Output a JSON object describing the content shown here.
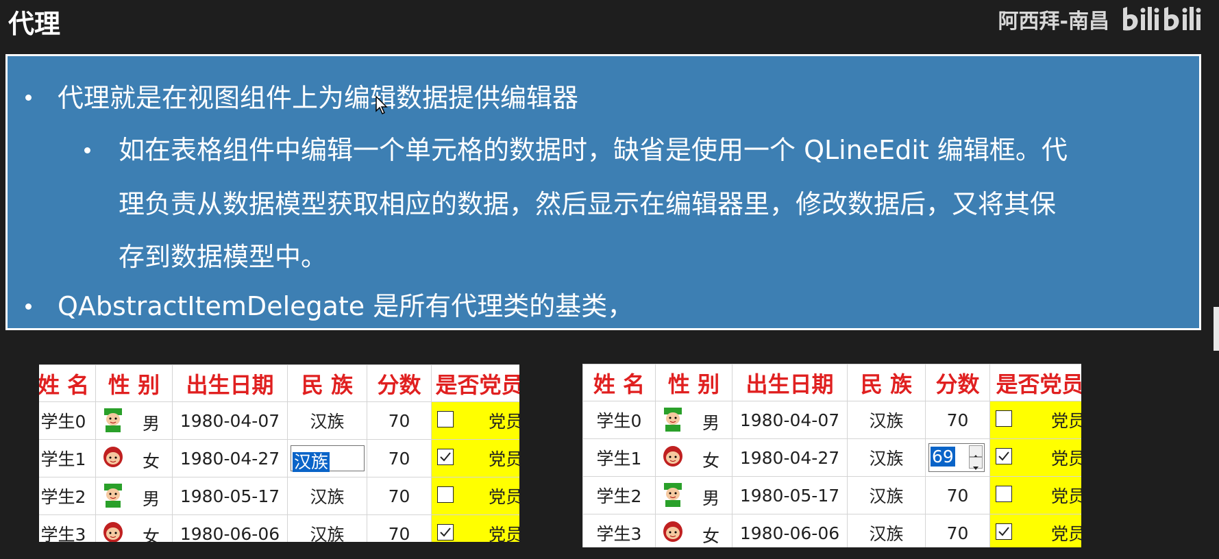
{
  "header": {
    "title": "代理",
    "author": "阿西拜-南昌",
    "logo": "bilibili"
  },
  "slide": {
    "bullet1": "代理就是在视图组件上为编辑数据提供编辑器",
    "sub_lines": [
      "如在表格组件中编辑一个单元格的数据时，缺省是使用一个 QLineEdit 编辑框。代",
      "理负责从数据模型获取相应的数据，然后显示在编辑器里，修改数据后，又将其保",
      "存到数据模型中。"
    ],
    "bullet2": "QAbstractItemDelegate 是所有代理类的基类，"
  },
  "table_left": {
    "headers": [
      "姓 名",
      "性 别",
      "出生日期",
      "民 族",
      "分数",
      "是否党员"
    ],
    "rows": [
      {
        "name": "学生0",
        "gender": "男",
        "avatar": "boy-icon",
        "birth": "1980-04-07",
        "ethnic": "汉族",
        "score": "70",
        "checked": false,
        "party": "党员"
      },
      {
        "name": "学生1",
        "gender": "女",
        "avatar": "girl-icon",
        "birth": "1980-04-27",
        "ethnic": "汉族",
        "score": "70",
        "checked": true,
        "party": "党员"
      },
      {
        "name": "学生2",
        "gender": "男",
        "avatar": "boy-icon",
        "birth": "1980-05-17",
        "ethnic": "汉族",
        "score": "70",
        "checked": false,
        "party": "党员"
      },
      {
        "name": "学生3",
        "gender": "女",
        "avatar": "girl-icon",
        "birth": "1980-06-06",
        "ethnic": "汉族",
        "score": "70",
        "checked": true,
        "party": "党员"
      }
    ],
    "editor_value": "汉族"
  },
  "table_right": {
    "headers": [
      "姓 名",
      "性 别",
      "出生日期",
      "民 族",
      "分数",
      "是否党员"
    ],
    "rows": [
      {
        "name": "学生0",
        "gender": "男",
        "avatar": "boy-icon",
        "birth": "1980-04-07",
        "ethnic": "汉族",
        "score": "70",
        "checked": false,
        "party": "党员"
      },
      {
        "name": "学生1",
        "gender": "女",
        "avatar": "girl-icon",
        "birth": "1980-04-27",
        "ethnic": "汉族",
        "score": "69",
        "checked": true,
        "party": "党员"
      },
      {
        "name": "学生2",
        "gender": "男",
        "avatar": "boy-icon",
        "birth": "1980-05-17",
        "ethnic": "汉族",
        "score": "70",
        "checked": false,
        "party": "党员"
      },
      {
        "name": "学生3",
        "gender": "女",
        "avatar": "girl-icon",
        "birth": "1980-06-06",
        "ethnic": "汉族",
        "score": "70",
        "checked": true,
        "party": "党员"
      }
    ],
    "spin_value": "69"
  },
  "colors": {
    "panel": "#3d7fb3",
    "header_text": "#e02020",
    "party_bg": "#ffff00",
    "selection": "#0a64c8"
  }
}
